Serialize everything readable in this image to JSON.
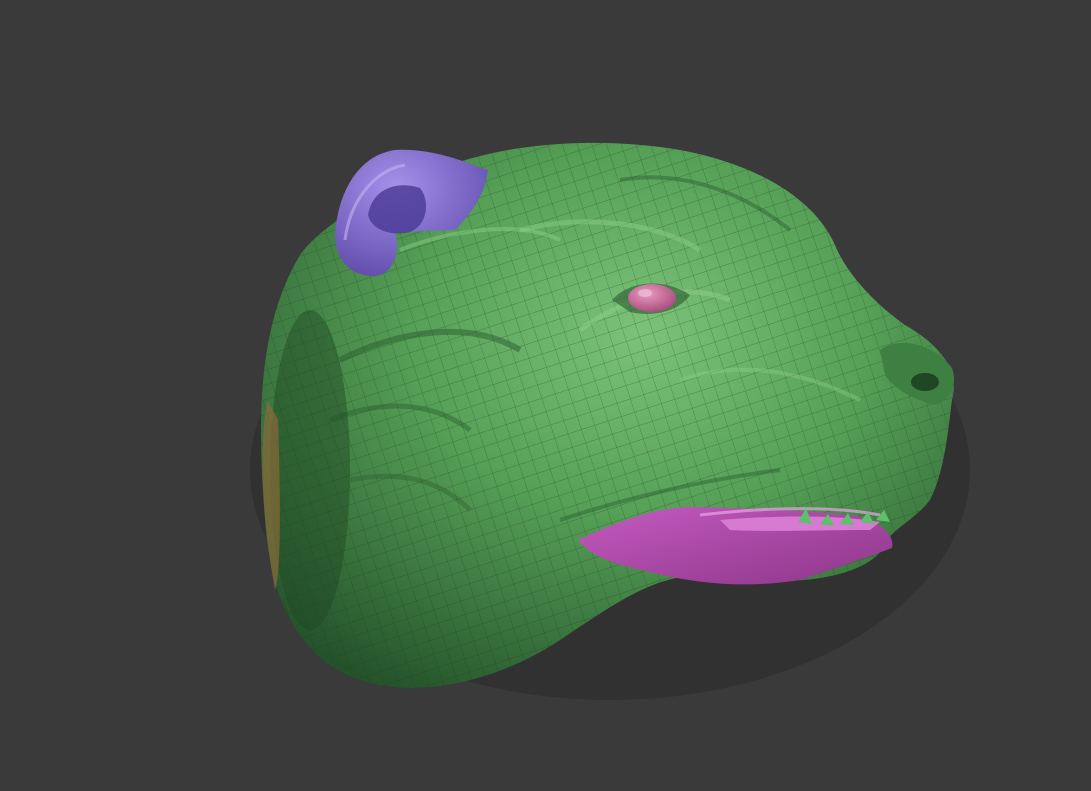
{
  "scene": {
    "background": "#3a3a3a",
    "subject": "sculpted-bear-head",
    "colors": {
      "skin": "#4f9a52",
      "skin_light": "#6fb86e",
      "skin_dark": "#2f6a33",
      "ear": "#7b63c9",
      "ear_light": "#9a85e0",
      "lip": "#b24bb0",
      "lip_light": "#d77ad2",
      "eye": "#c8679a",
      "teeth": "#5fbf6a",
      "wire": "#1e3a20",
      "shadow": "#222222"
    }
  }
}
